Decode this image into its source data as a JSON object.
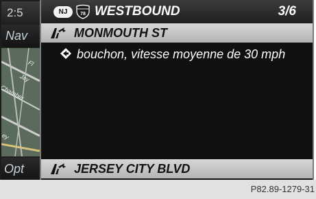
{
  "background": {
    "clock": "2:5",
    "nav_label": "Nav",
    "options_label": "Opt",
    "map_labels": [
      "Chamber",
      "Jay",
      "Fl",
      "ey"
    ]
  },
  "header": {
    "state_badge": "NJ",
    "route_number": "78",
    "direction": "WESTBOUND",
    "page_indicator": "3/6"
  },
  "current_street": {
    "icon": "road-arrow-icon",
    "name": "MONMOUTH ST"
  },
  "traffic_message": {
    "icon": "warning-diamond-icon",
    "text": "bouchon, vitesse moyenne de 30 mph"
  },
  "next_street": {
    "icon": "road-arrow-icon",
    "name": "JERSEY CITY BLVD"
  },
  "footer": {
    "figure_code": "P82.89-1279-31"
  },
  "colors": {
    "panel_background": "#111111",
    "row_highlight": "#c8c8c8",
    "text_primary": "#ffffff"
  }
}
